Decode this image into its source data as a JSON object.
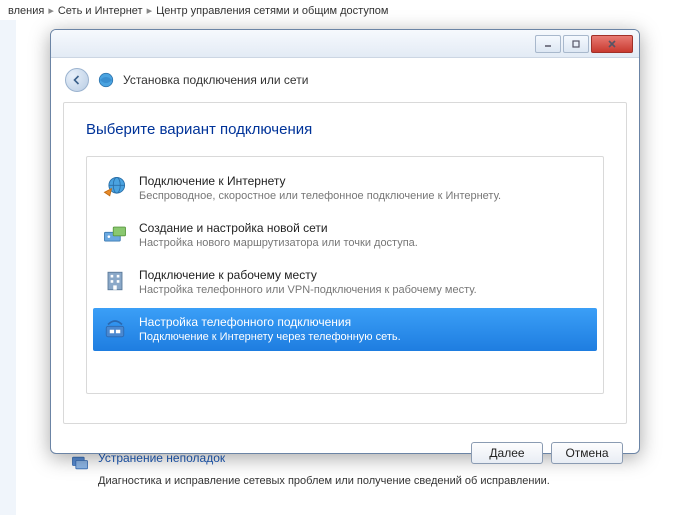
{
  "breadcrumb": {
    "item1": "вления",
    "item2": "Сеть и Интернет",
    "item3": "Центр управления сетями и общим доступом"
  },
  "dialog": {
    "wizard_title": "Установка подключения или сети",
    "instruction": "Выберите вариант подключения",
    "options": [
      {
        "title": "Подключение к Интернету",
        "desc": "Беспроводное, скоростное или телефонное подключение к Интернету."
      },
      {
        "title": "Создание и настройка новой сети",
        "desc": "Настройка нового маршрутизатора или точки доступа."
      },
      {
        "title": "Подключение к рабочему месту",
        "desc": "Настройка телефонного или VPN-подключения к рабочему месту."
      },
      {
        "title": "Настройка телефонного подключения",
        "desc": "Подключение к Интернету через телефонную сеть."
      }
    ],
    "buttons": {
      "next": "Далее",
      "cancel": "Отмена"
    }
  },
  "troubleshoot": {
    "title": "Устранение неполадок",
    "desc": "Диагностика и исправление сетевых проблем или получение сведений об исправлении."
  }
}
